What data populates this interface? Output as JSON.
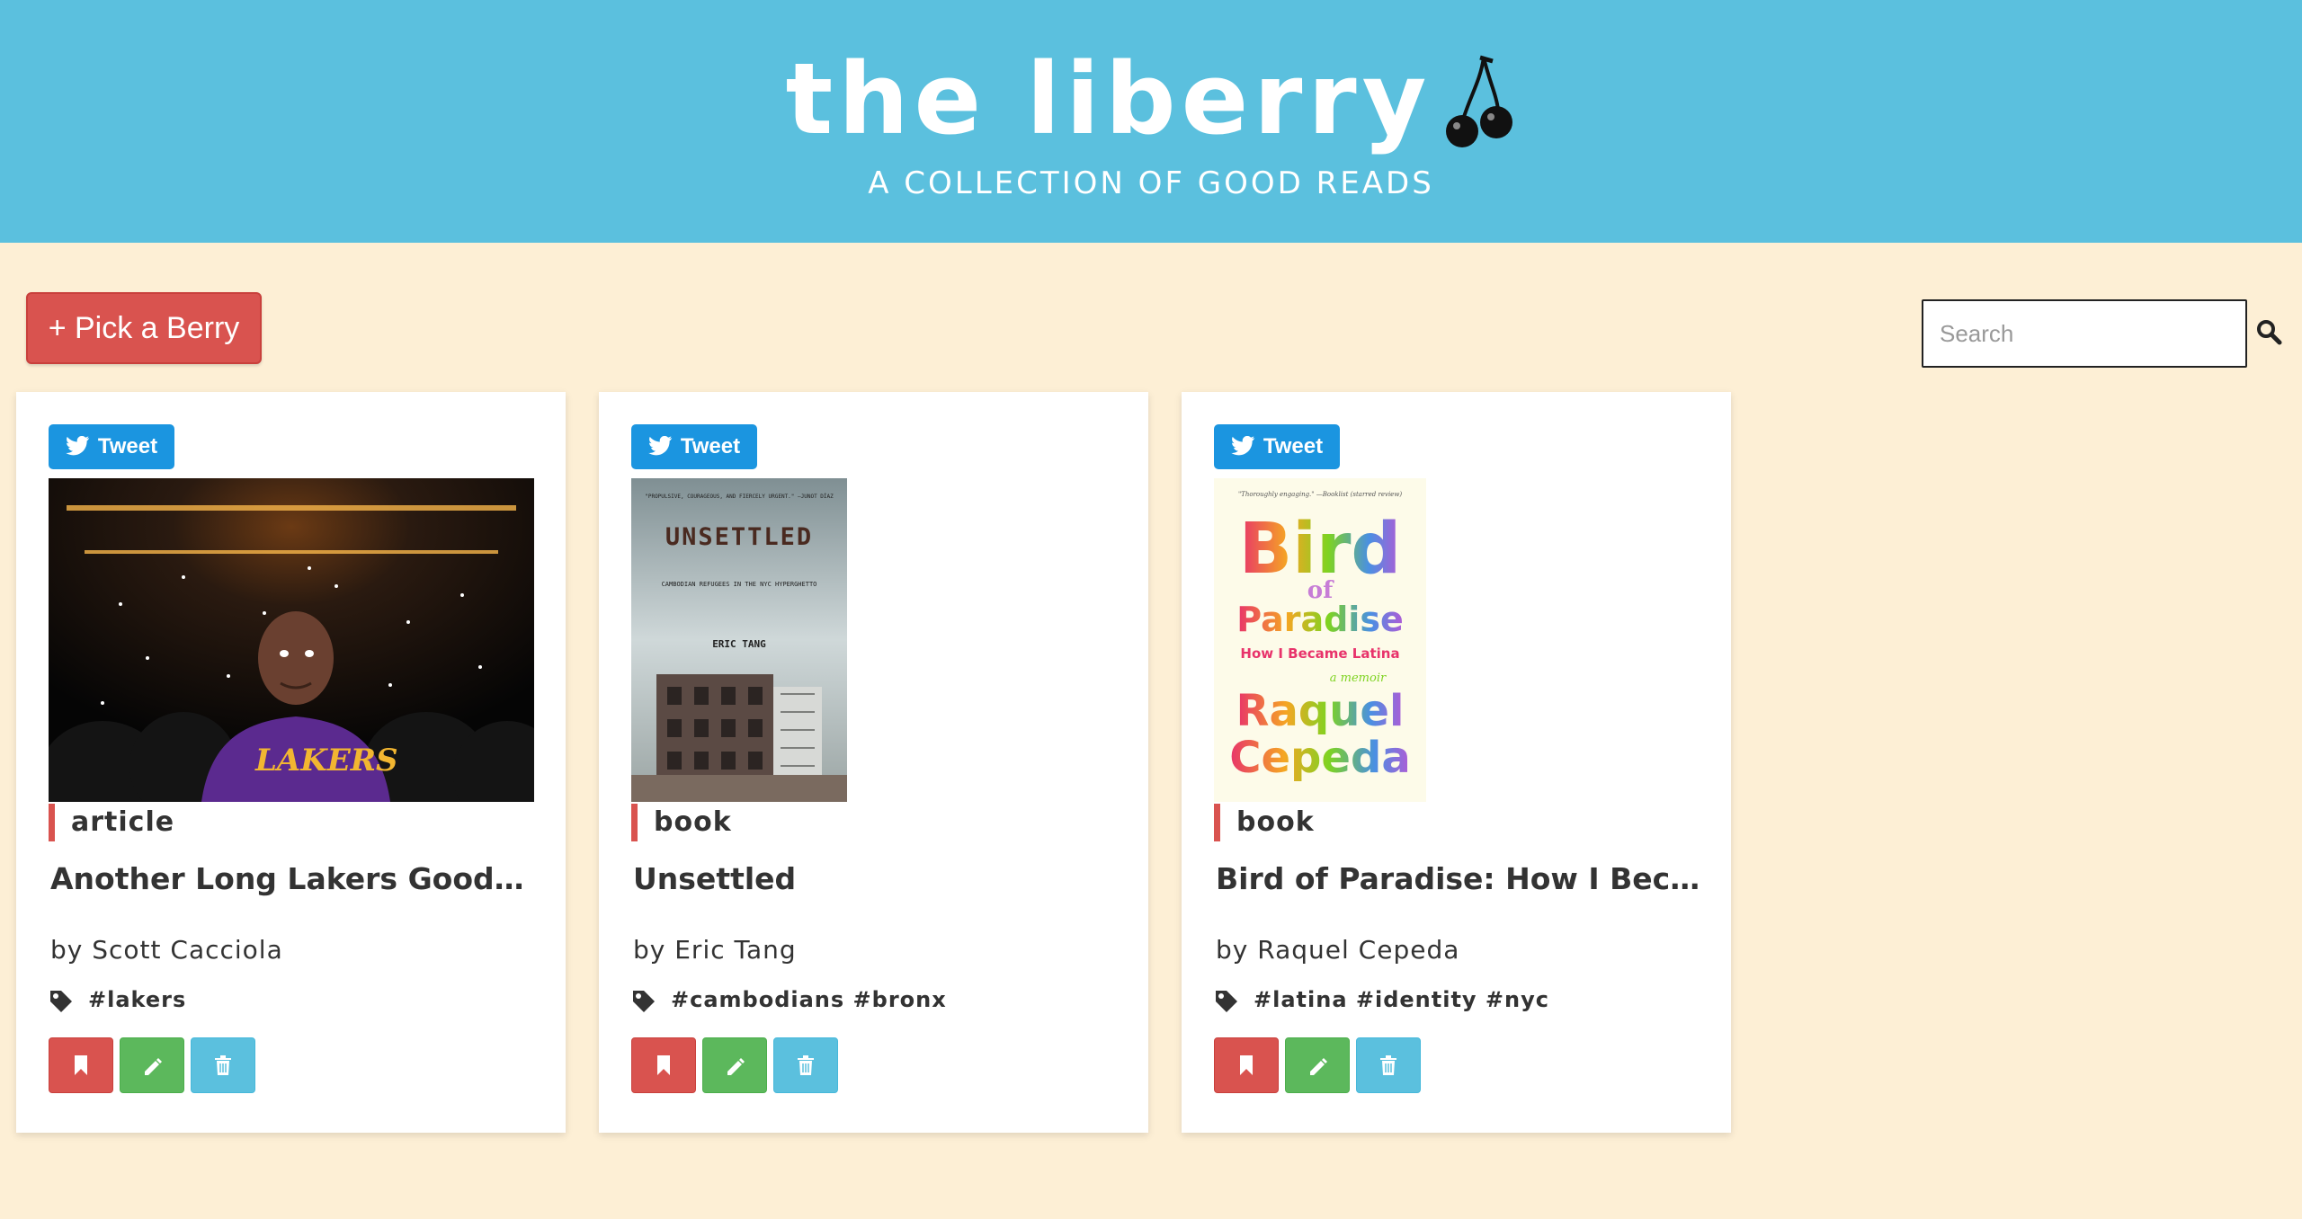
{
  "header": {
    "title": "the liberry",
    "tagline": "A COLLECTION OF GOOD READS",
    "background": "#5bc0de"
  },
  "toolbar": {
    "pick_label": "+ Pick a Berry",
    "search_placeholder": "Search"
  },
  "cards": [
    {
      "tweet_label": "Tweet",
      "type": "article",
      "title": "Another Long Lakers Goodbye, for Kobe Bryant",
      "author": "by Scott Cacciola",
      "tags": "#lakers"
    },
    {
      "tweet_label": "Tweet",
      "type": "book",
      "title": "Unsettled",
      "author": "by Eric Tang",
      "tags": "#cambodians #bronx",
      "cover": {
        "blurb": "\"PROPULSIVE, COURAGEOUS, AND FIERCELY URGENT.\" —JUNOT DÍAZ",
        "title": "UNSETTLED",
        "subtitle": "CAMBODIAN REFUGEES IN THE NYC HYPERGHETTO",
        "author": "ERIC TANG"
      }
    },
    {
      "tweet_label": "Tweet",
      "type": "book",
      "title": "Bird of Paradise: How I Became Latina",
      "author": "by Raquel Cepeda",
      "tags": "#latina #identity #nyc",
      "cover": {
        "blurb": "\"Thoroughly engaging.\" —Booklist (starred review)",
        "line1": "Bird",
        "line2": "of",
        "line3": "Paradise",
        "line4": "How I Became Latina",
        "line5": "a memoir",
        "line6": "Raquel",
        "line7": "Cepeda"
      }
    }
  ],
  "jersey_text": "LAKERS"
}
